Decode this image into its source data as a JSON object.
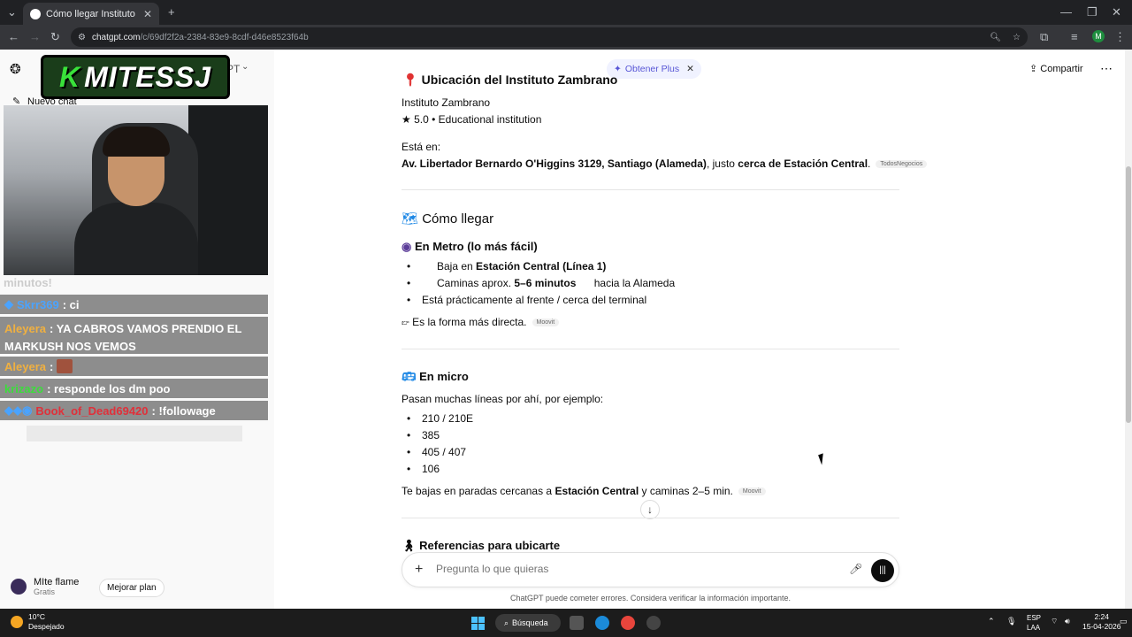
{
  "browser": {
    "tab_title": "Cómo llegar Instituto Zambrano",
    "url_domain": "chatgpt.com",
    "url_path": "/c/69df2f2a-2384-83e9-8cdf-d46e8523f64b",
    "profile_initial": "M"
  },
  "sidebar": {
    "new_chat": "Nuevo chat",
    "title_fragment": "PT",
    "overlay_logo": "MITESSJ",
    "overlay_logo_k": "K",
    "user_name": "MIte flame",
    "user_plan": "Gratis",
    "upgrade_label": "Mejorar plan"
  },
  "stream_chat": [
    {
      "user": "",
      "text": "minutos!",
      "ghost": true
    },
    {
      "user": "Skrr369",
      "text": ": ci",
      "user_color": "#4aa3ff"
    },
    {
      "user": "Aleyera",
      "text": ": YA CABROS VAMOS PRENDIO EL MARKUSH NOS VEMOS",
      "user_color": "#f0b040"
    },
    {
      "user": "Aleyera",
      "text": ":",
      "user_color": "#f0b040"
    },
    {
      "user": "krizazo",
      "text": ": responde los dm poo",
      "user_color": "#3ddc3d"
    },
    {
      "user": "Book_of_Dead69420",
      "text": ": !followage",
      "user_color": "#e0303a"
    }
  ],
  "header": {
    "obtain_plus": "Obtener Plus",
    "share": "Compartir"
  },
  "content": {
    "location_title": "Ubicación del Instituto Zambrano",
    "place_name": "Instituto Zambrano",
    "rating": "5.0 • Educational institution",
    "esta_en": "Está en:",
    "address_bold": "Av. Libertador Bernardo O'Higgins 3129, Santiago (Alameda)",
    "address_mid": ", justo ",
    "address_near": "cerca de Estación Central",
    "address_tag": "TodosNegocios",
    "como_llegar": "Cómo llegar",
    "metro_title": "En Metro (lo más fácil)",
    "metro_b1_pre": "Baja en ",
    "metro_b1_bold": "Estación Central (Línea 1)",
    "metro_b2_pre": "Caminas aprox. ",
    "metro_b2_bold": "5–6 minutos",
    "metro_b2_post": " hacia la Alameda",
    "metro_b3": "Está prácticamente al frente / cerca del terminal",
    "metro_tip": "Es la forma más directa.",
    "metro_tag": "Moovit",
    "micro_title": "En micro",
    "micro_intro": "Pasan muchas líneas por ahí, por ejemplo:",
    "micro_lines": [
      "210 / 210E",
      "385",
      "405 / 407",
      "106"
    ],
    "micro_pre": "Te bajas en paradas cercanas a ",
    "micro_bold": "Estación Central",
    "micro_post": " y caminas 2–5 min.",
    "micro_tag": "Moovit",
    "references_title": "Referencias para ubicarte"
  },
  "composer": {
    "placeholder": "Pregunta lo que quieras",
    "disclaimer": "ChatGPT puede cometer errores. Considera verificar la información importante."
  },
  "taskbar": {
    "temp": "10°C",
    "weather": "Despejado",
    "search": "Búsqueda",
    "lang1": "ESP",
    "lang2": "LAA",
    "time": "2:24",
    "date": "15-04-2026"
  }
}
